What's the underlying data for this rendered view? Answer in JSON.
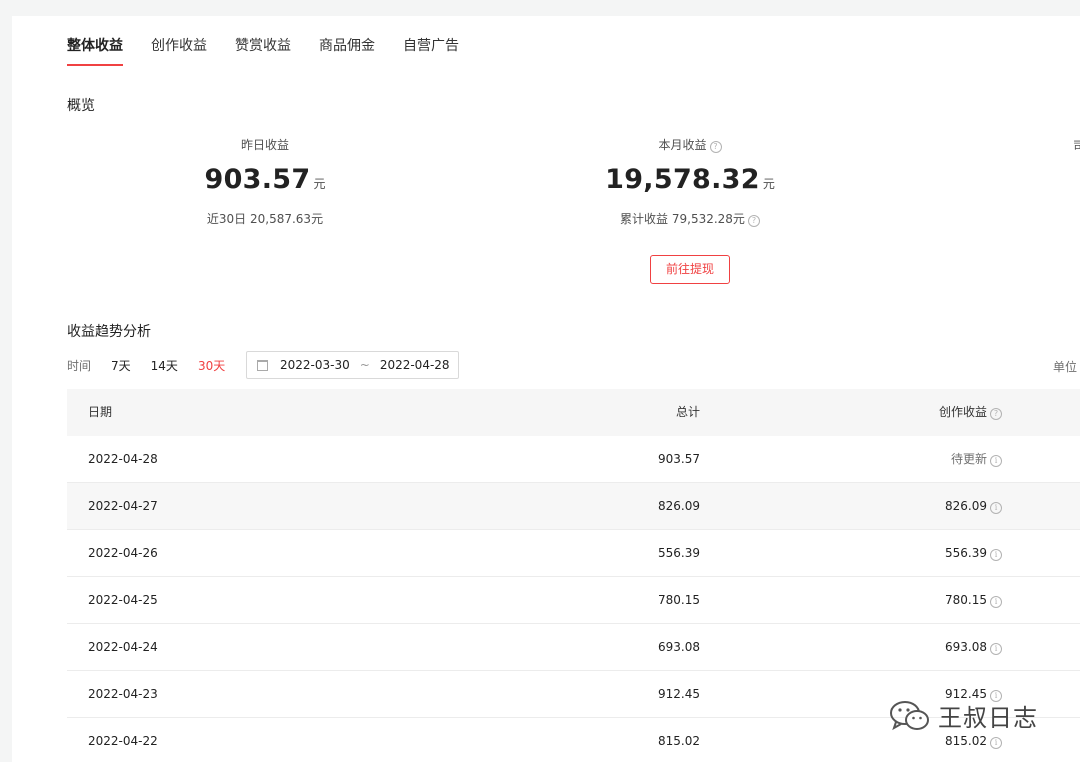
{
  "tabs": [
    {
      "label": "整体收益",
      "active": true
    },
    {
      "label": "创作收益",
      "active": false
    },
    {
      "label": "赞赏收益",
      "active": false
    },
    {
      "label": "商品佣金",
      "active": false
    },
    {
      "label": "自营广告",
      "active": false
    }
  ],
  "overview": {
    "title": "概览",
    "yesterday": {
      "label": "昨日收益",
      "value": "903.57",
      "unit": "元",
      "sub": "近30日 20,587.63元"
    },
    "month": {
      "label": "本月收益",
      "value": "19,578.32",
      "unit": "元",
      "sub": "累计收益 79,532.28元"
    },
    "withdraw_label": "前往提现",
    "partial_label": "司"
  },
  "trend": {
    "title": "收益趋势分析",
    "time_label": "时间",
    "options": [
      "7天",
      "14天",
      "30天"
    ],
    "selected": "30天",
    "date_start": "2022-03-30",
    "date_sep": "~",
    "date_end": "2022-04-28",
    "unit_label": "单位"
  },
  "table": {
    "headers": {
      "date": "日期",
      "total": "总计",
      "creation": "创作收益"
    },
    "rows": [
      {
        "date": "2022-04-28",
        "total": "903.57",
        "creation": "待更新"
      },
      {
        "date": "2022-04-27",
        "total": "826.09",
        "creation": "826.09"
      },
      {
        "date": "2022-04-26",
        "total": "556.39",
        "creation": "556.39"
      },
      {
        "date": "2022-04-25",
        "total": "780.15",
        "creation": "780.15"
      },
      {
        "date": "2022-04-24",
        "total": "693.08",
        "creation": "693.08"
      },
      {
        "date": "2022-04-23",
        "total": "912.45",
        "creation": "912.45"
      },
      {
        "date": "2022-04-22",
        "total": "815.02",
        "creation": "815.02"
      }
    ]
  },
  "watermark": {
    "text": "王叔日志"
  },
  "colors": {
    "accent": "#f04142",
    "background": "#f4f5f5",
    "card": "#ffffff",
    "header_bg": "#f6f6f6"
  }
}
